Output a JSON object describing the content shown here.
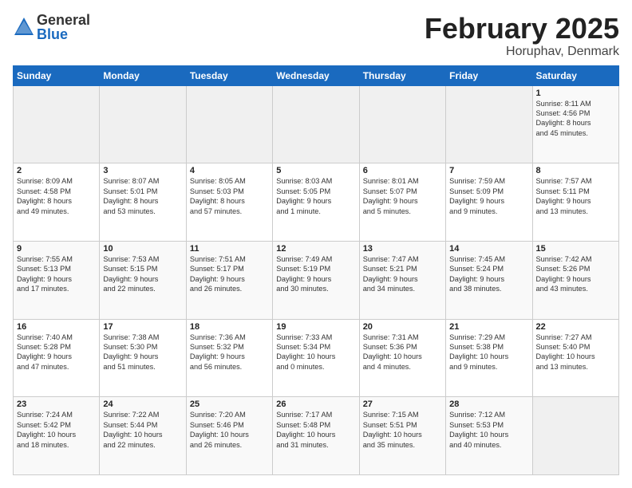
{
  "logo": {
    "general": "General",
    "blue": "Blue"
  },
  "title": "February 2025",
  "location": "Horuphav, Denmark",
  "days_of_week": [
    "Sunday",
    "Monday",
    "Tuesday",
    "Wednesday",
    "Thursday",
    "Friday",
    "Saturday"
  ],
  "weeks": [
    [
      {
        "day": "",
        "info": ""
      },
      {
        "day": "",
        "info": ""
      },
      {
        "day": "",
        "info": ""
      },
      {
        "day": "",
        "info": ""
      },
      {
        "day": "",
        "info": ""
      },
      {
        "day": "",
        "info": ""
      },
      {
        "day": "1",
        "info": "Sunrise: 8:11 AM\nSunset: 4:56 PM\nDaylight: 8 hours\nand 45 minutes."
      }
    ],
    [
      {
        "day": "2",
        "info": "Sunrise: 8:09 AM\nSunset: 4:58 PM\nDaylight: 8 hours\nand 49 minutes."
      },
      {
        "day": "3",
        "info": "Sunrise: 8:07 AM\nSunset: 5:01 PM\nDaylight: 8 hours\nand 53 minutes."
      },
      {
        "day": "4",
        "info": "Sunrise: 8:05 AM\nSunset: 5:03 PM\nDaylight: 8 hours\nand 57 minutes."
      },
      {
        "day": "5",
        "info": "Sunrise: 8:03 AM\nSunset: 5:05 PM\nDaylight: 9 hours\nand 1 minute."
      },
      {
        "day": "6",
        "info": "Sunrise: 8:01 AM\nSunset: 5:07 PM\nDaylight: 9 hours\nand 5 minutes."
      },
      {
        "day": "7",
        "info": "Sunrise: 7:59 AM\nSunset: 5:09 PM\nDaylight: 9 hours\nand 9 minutes."
      },
      {
        "day": "8",
        "info": "Sunrise: 7:57 AM\nSunset: 5:11 PM\nDaylight: 9 hours\nand 13 minutes."
      }
    ],
    [
      {
        "day": "9",
        "info": "Sunrise: 7:55 AM\nSunset: 5:13 PM\nDaylight: 9 hours\nand 17 minutes."
      },
      {
        "day": "10",
        "info": "Sunrise: 7:53 AM\nSunset: 5:15 PM\nDaylight: 9 hours\nand 22 minutes."
      },
      {
        "day": "11",
        "info": "Sunrise: 7:51 AM\nSunset: 5:17 PM\nDaylight: 9 hours\nand 26 minutes."
      },
      {
        "day": "12",
        "info": "Sunrise: 7:49 AM\nSunset: 5:19 PM\nDaylight: 9 hours\nand 30 minutes."
      },
      {
        "day": "13",
        "info": "Sunrise: 7:47 AM\nSunset: 5:21 PM\nDaylight: 9 hours\nand 34 minutes."
      },
      {
        "day": "14",
        "info": "Sunrise: 7:45 AM\nSunset: 5:24 PM\nDaylight: 9 hours\nand 38 minutes."
      },
      {
        "day": "15",
        "info": "Sunrise: 7:42 AM\nSunset: 5:26 PM\nDaylight: 9 hours\nand 43 minutes."
      }
    ],
    [
      {
        "day": "16",
        "info": "Sunrise: 7:40 AM\nSunset: 5:28 PM\nDaylight: 9 hours\nand 47 minutes."
      },
      {
        "day": "17",
        "info": "Sunrise: 7:38 AM\nSunset: 5:30 PM\nDaylight: 9 hours\nand 51 minutes."
      },
      {
        "day": "18",
        "info": "Sunrise: 7:36 AM\nSunset: 5:32 PM\nDaylight: 9 hours\nand 56 minutes."
      },
      {
        "day": "19",
        "info": "Sunrise: 7:33 AM\nSunset: 5:34 PM\nDaylight: 10 hours\nand 0 minutes."
      },
      {
        "day": "20",
        "info": "Sunrise: 7:31 AM\nSunset: 5:36 PM\nDaylight: 10 hours\nand 4 minutes."
      },
      {
        "day": "21",
        "info": "Sunrise: 7:29 AM\nSunset: 5:38 PM\nDaylight: 10 hours\nand 9 minutes."
      },
      {
        "day": "22",
        "info": "Sunrise: 7:27 AM\nSunset: 5:40 PM\nDaylight: 10 hours\nand 13 minutes."
      }
    ],
    [
      {
        "day": "23",
        "info": "Sunrise: 7:24 AM\nSunset: 5:42 PM\nDaylight: 10 hours\nand 18 minutes."
      },
      {
        "day": "24",
        "info": "Sunrise: 7:22 AM\nSunset: 5:44 PM\nDaylight: 10 hours\nand 22 minutes."
      },
      {
        "day": "25",
        "info": "Sunrise: 7:20 AM\nSunset: 5:46 PM\nDaylight: 10 hours\nand 26 minutes."
      },
      {
        "day": "26",
        "info": "Sunrise: 7:17 AM\nSunset: 5:48 PM\nDaylight: 10 hours\nand 31 minutes."
      },
      {
        "day": "27",
        "info": "Sunrise: 7:15 AM\nSunset: 5:51 PM\nDaylight: 10 hours\nand 35 minutes."
      },
      {
        "day": "28",
        "info": "Sunrise: 7:12 AM\nSunset: 5:53 PM\nDaylight: 10 hours\nand 40 minutes."
      },
      {
        "day": "",
        "info": ""
      }
    ]
  ]
}
